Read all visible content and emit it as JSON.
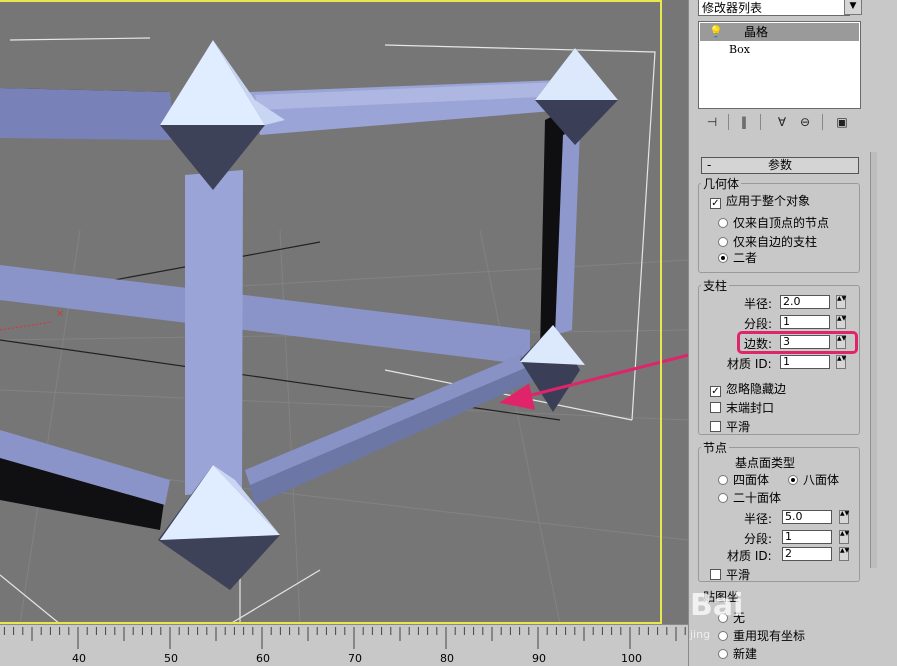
{
  "modifier_list": {
    "label": "修改器列表",
    "arrow": "▼"
  },
  "stack": {
    "selected": "晶格",
    "sub_item": "Box"
  },
  "rollout": {
    "title": "参数",
    "collapse": "-"
  },
  "geometry": {
    "label": "几何体",
    "apply_whole": "应用于整个对象",
    "apply_whole_checked": true,
    "options": [
      {
        "label": "仅来自顶点的节点",
        "selected": false
      },
      {
        "label": "仅来自边的支柱",
        "selected": false
      },
      {
        "label": "二者",
        "selected": true
      }
    ]
  },
  "struts": {
    "label": "支柱",
    "radius_label": "半径:",
    "radius_value": "2.0",
    "segments_label": "分段:",
    "segments_value": "1",
    "sides_label": "边数:",
    "sides_value": "3",
    "matid_label": "材质 ID:",
    "matid_value": "1",
    "ignore_hidden": "忽略隐藏边",
    "ignore_hidden_checked": true,
    "end_caps": "末端封口",
    "end_caps_checked": false,
    "smooth": "平滑",
    "smooth_checked": false
  },
  "joints": {
    "label": "节点",
    "base_type_label": "基点面类型",
    "types": [
      {
        "label": "四面体",
        "selected": false
      },
      {
        "label": "八面体",
        "selected": true
      },
      {
        "label": "二十面体",
        "selected": false
      }
    ],
    "radius_label": "半径:",
    "radius_value": "5.0",
    "segments_label": "分段:",
    "segments_value": "1",
    "matid_label": "材质 ID:",
    "matid_value": "2",
    "smooth": "平滑",
    "smooth_checked": false
  },
  "mapping": {
    "label": "贴图坐",
    "none": "无",
    "reuse": "重用现有坐标",
    "new": "新建"
  },
  "ruler": {
    "labels": [
      "40",
      "50",
      "60",
      "70",
      "80",
      "90",
      "100"
    ]
  },
  "watermark": {
    "brand": "Bai",
    "sub": "jing"
  },
  "colors": {
    "viewport_bg": "#767676",
    "strut": "#9aa4d6",
    "highlight": "#e0246a",
    "active_border": "#e8e84a"
  },
  "icons": {
    "pin": "pin-icon",
    "show_end": "show-end-result-icon",
    "unique": "make-unique-icon",
    "remove": "remove-modifier-icon",
    "configure": "configure-sets-icon"
  }
}
